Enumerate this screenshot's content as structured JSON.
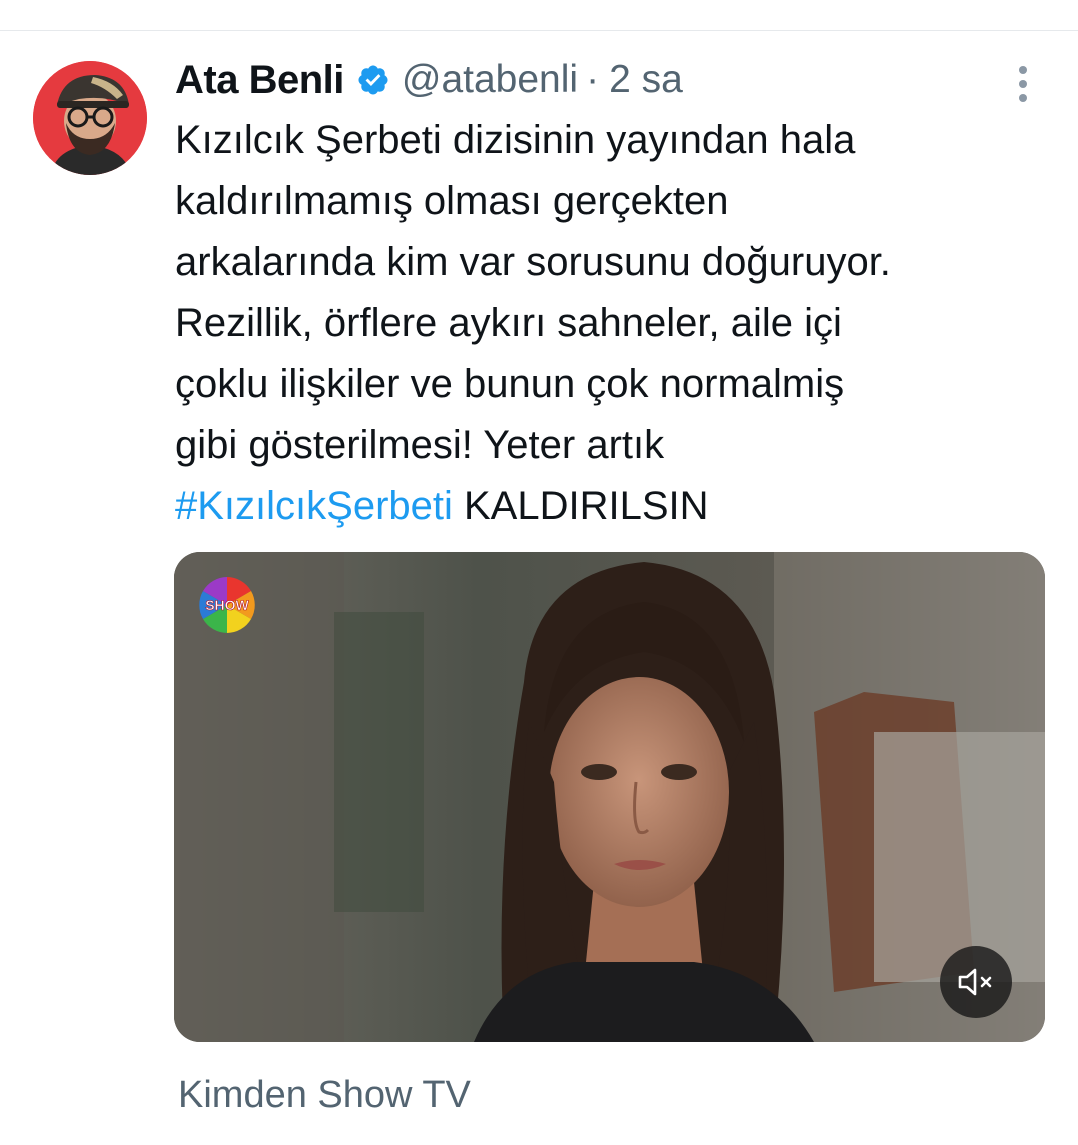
{
  "tweet": {
    "author": {
      "display_name": "Ata Benli",
      "handle": "@atabenli",
      "verified_icon": "verified-badge-icon"
    },
    "separator": "·",
    "time": "2 sa",
    "text_lines": [
      "Kızılcık Şerbeti dizisinin yayından hala",
      "kaldırılmamış olması gerçekten",
      "arkalarında kim var sorusunu doğuruyor.",
      "Rezillik, örflere aykırı sahneler, aile içi",
      "çoklu ilişkiler ve bunun çok normalmiş",
      "gibi gösterilmesi! Yeter artık"
    ],
    "hashtag": "#KızılcıkŞerbeti",
    "after_hashtag": " KALDIRILSIN",
    "media": {
      "logo_text": "SHOW",
      "mute_icon": "volume-muted-icon"
    },
    "source": "Kimden Show TV",
    "more_icon": "more-vertical-icon"
  },
  "colors": {
    "text": "#0f1419",
    "secondary": "#536471",
    "link": "#1d9bf0",
    "verified": "#1d9bf0",
    "divider": "#e6e9ec"
  }
}
